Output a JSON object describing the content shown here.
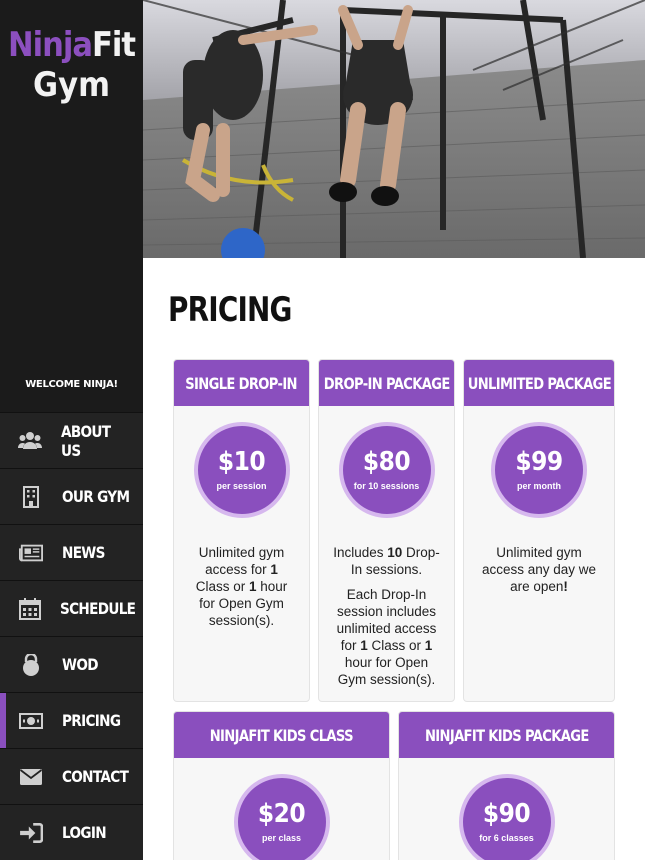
{
  "brand": {
    "name_part1": "Ninja",
    "name_part2": "Fit",
    "name_line2": "Gym",
    "accent": "#8a4fbe"
  },
  "sidebar": {
    "welcome": "WELCOME NINJA!",
    "items": [
      {
        "label": "ABOUT US",
        "icon": "users-icon"
      },
      {
        "label": "OUR GYM",
        "icon": "building-icon"
      },
      {
        "label": "NEWS",
        "icon": "newspaper-icon"
      },
      {
        "label": "SCHEDULE",
        "icon": "calendar-icon"
      },
      {
        "label": "WOD",
        "icon": "kettlebell-icon"
      },
      {
        "label": "PRICING",
        "icon": "money-icon",
        "active": true
      },
      {
        "label": "CONTACT",
        "icon": "envelope-icon"
      },
      {
        "label": "LOGIN",
        "icon": "sign-in-icon"
      }
    ]
  },
  "main": {
    "title": "PRICING",
    "cards": [
      {
        "title": "SINGLE DROP-IN",
        "price": "$10",
        "unit": "per session",
        "desc": [
          [
            "Unlimited gym access for ",
            {
              "b": "1"
            },
            " Class or ",
            {
              "b": "1"
            },
            " hour for Open Gym session(s)."
          ]
        ]
      },
      {
        "title": "DROP-IN PACKAGE",
        "price": "$80",
        "unit": "for 10 sessions",
        "desc": [
          [
            "Includes ",
            {
              "b": "10"
            },
            " Drop-In sessions."
          ],
          [
            "Each Drop-In session includes unlimited access for ",
            {
              "b": "1"
            },
            " Class or ",
            {
              "b": "1"
            },
            " hour for Open Gym session(s)."
          ]
        ]
      },
      {
        "title": "UNLIMITED PACKAGE",
        "price": "$99",
        "unit": "per month",
        "desc": [
          [
            "Unlimited gym access any day we are open",
            {
              "b": "!"
            }
          ]
        ]
      },
      {
        "title": "NINJAFIT KIDS CLASS",
        "price": "$20",
        "unit": "per class",
        "desc": []
      },
      {
        "title": "NINJAFIT KIDS PACKAGE",
        "price": "$90",
        "unit": "for 6 classes",
        "desc": []
      }
    ]
  }
}
